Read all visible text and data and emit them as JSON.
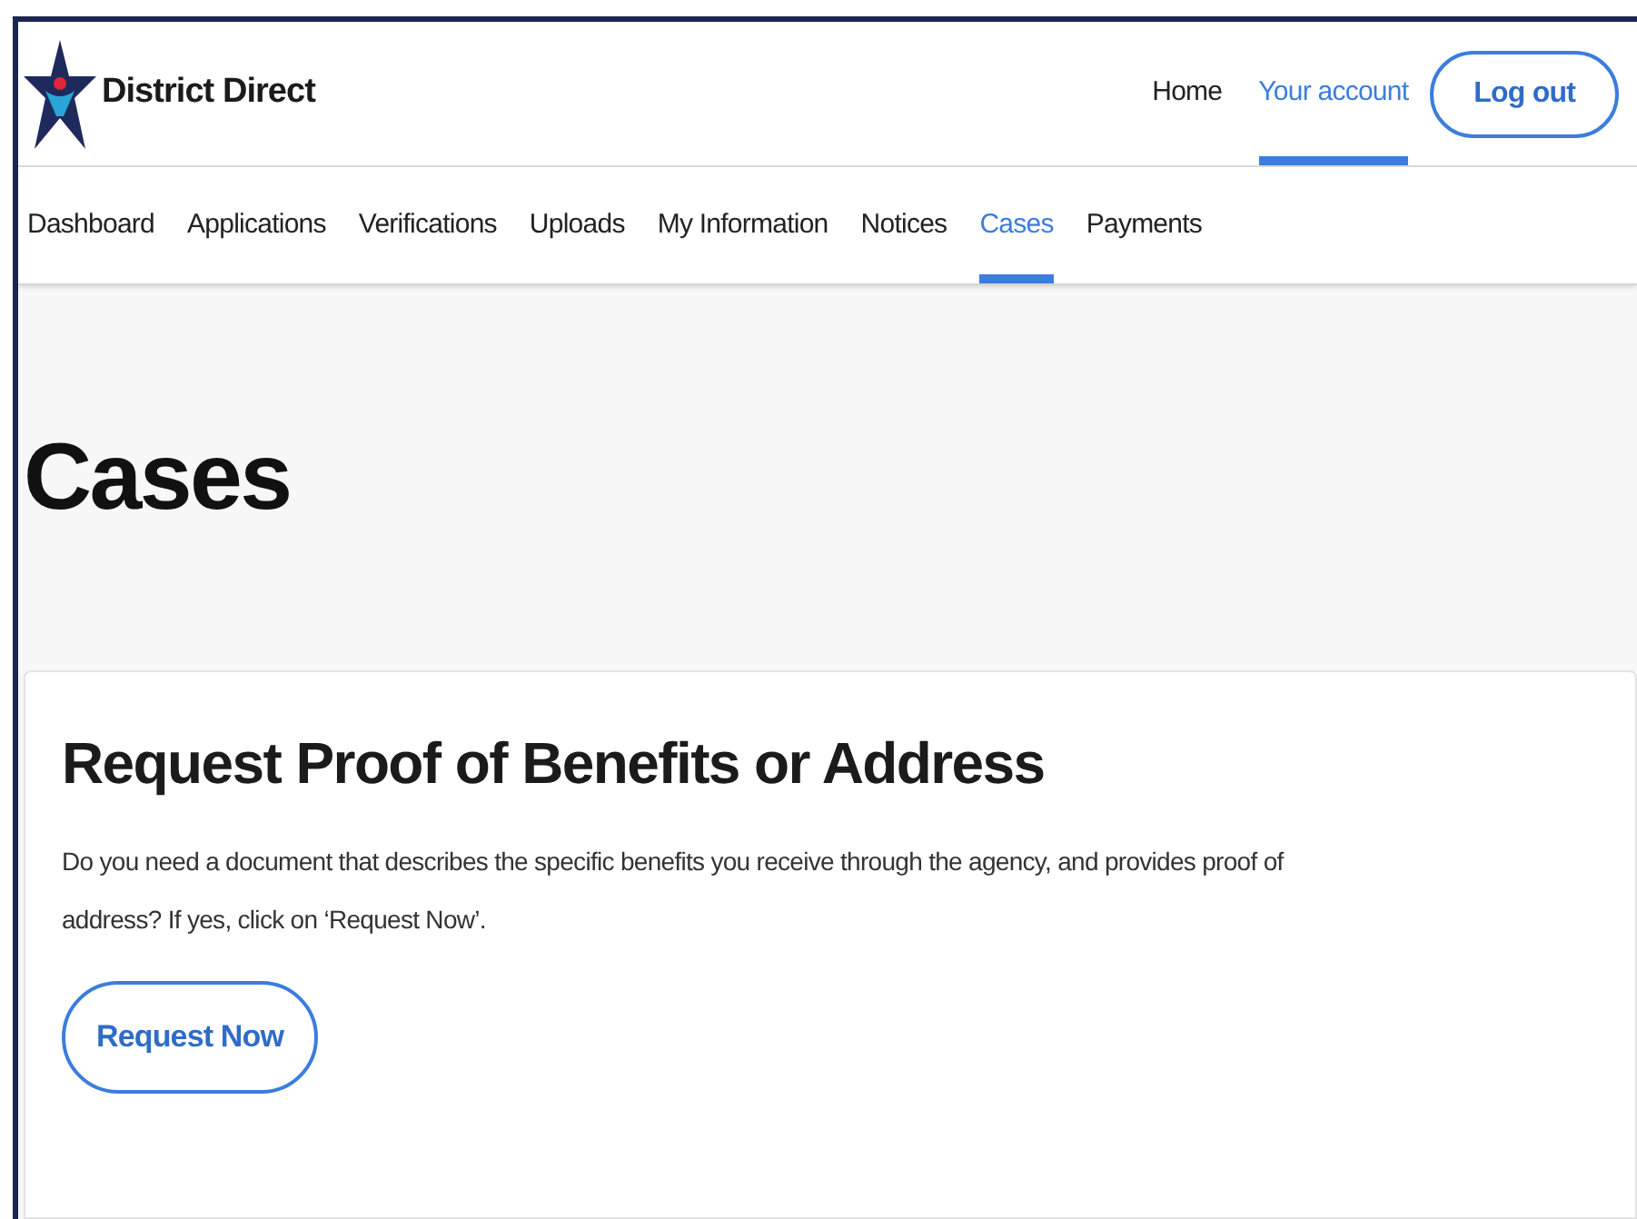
{
  "header": {
    "brand": "District Direct",
    "links": [
      {
        "label": "Home",
        "selected": false
      },
      {
        "label": "Your account",
        "selected": true
      }
    ],
    "logout": "Log out"
  },
  "nav": [
    {
      "label": "Dashboard",
      "selected": false
    },
    {
      "label": "Applications",
      "selected": false
    },
    {
      "label": "Verifications",
      "selected": false
    },
    {
      "label": "Uploads",
      "selected": false
    },
    {
      "label": "My Information",
      "selected": false
    },
    {
      "label": "Notices",
      "selected": false
    },
    {
      "label": "Cases",
      "selected": true
    },
    {
      "label": "Payments",
      "selected": false
    }
  ],
  "page_title": "Cases",
  "card": {
    "title": "Request Proof of Benefits or Address",
    "body": "Do you need a document that describes the specific benefits you receive through the agency, and provides proof of address? If yes, click on ‘Request Now’.",
    "button": "Request Now"
  }
}
